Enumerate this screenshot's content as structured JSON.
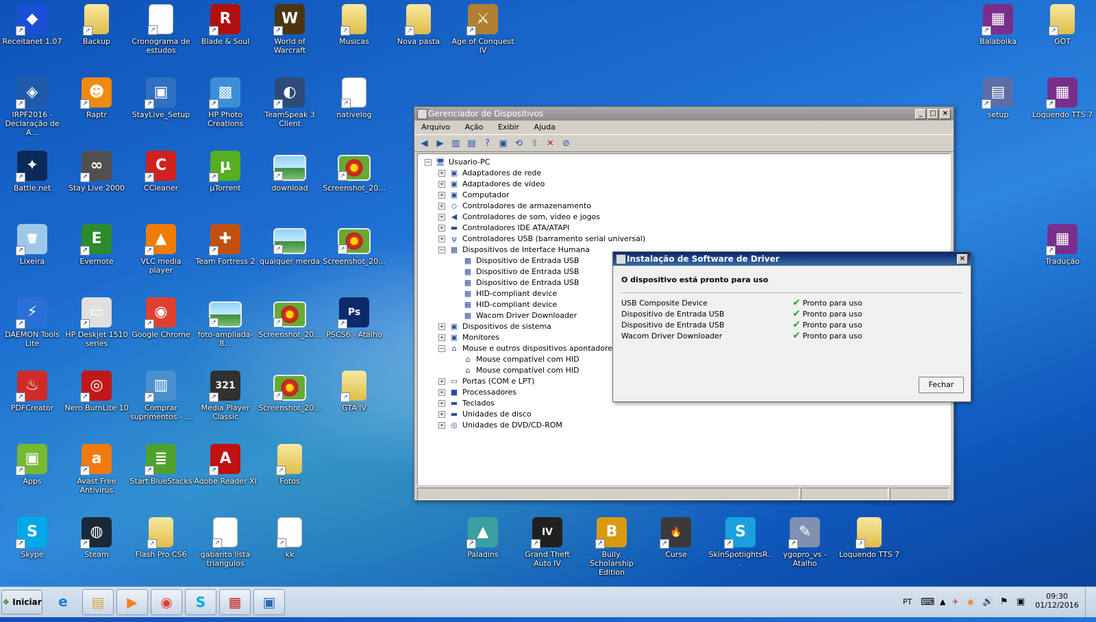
{
  "desktop": {
    "icons": [
      {
        "label": "Receitanet 1.07",
        "col": 0,
        "row": 0,
        "kind": "app",
        "color": "#1b4fd8",
        "glyph": "◆"
      },
      {
        "label": "Backup",
        "col": 1,
        "row": 0,
        "kind": "folder"
      },
      {
        "label": "Cronograma de estudos",
        "col": 2,
        "row": 0,
        "kind": "doc"
      },
      {
        "label": "Blade & Soul",
        "col": 3,
        "row": 0,
        "kind": "app",
        "color": "#b01010",
        "glyph": "R"
      },
      {
        "label": "World of Warcraft",
        "col": 4,
        "row": 0,
        "kind": "app",
        "color": "#4a3510",
        "glyph": "W"
      },
      {
        "label": "Musicas",
        "col": 5,
        "row": 0,
        "kind": "folder"
      },
      {
        "label": "Nova pasta",
        "col": 6,
        "row": 0,
        "kind": "folder"
      },
      {
        "label": "Age of Conquest IV",
        "col": 7,
        "row": 0,
        "kind": "app",
        "color": "#b08030",
        "glyph": "⚔"
      },
      {
        "label": "Balabolka",
        "col": 15,
        "row": 0,
        "kind": "app",
        "color": "#7a2e8a",
        "glyph": "▦"
      },
      {
        "label": "GOT",
        "col": 16,
        "row": 0,
        "kind": "folder"
      },
      {
        "label": "IRPF2016 - Declaração de A...",
        "col": 0,
        "row": 1,
        "kind": "app",
        "color": "#1e5aa8",
        "glyph": "◈"
      },
      {
        "label": "Raptr",
        "col": 1,
        "row": 1,
        "kind": "app",
        "color": "#f08a10",
        "glyph": "☻"
      },
      {
        "label": "StayLive_Setup",
        "col": 2,
        "row": 1,
        "kind": "app",
        "color": "#3070c0",
        "glyph": "▣"
      },
      {
        "label": "HP Photo Creations",
        "col": 3,
        "row": 1,
        "kind": "app",
        "color": "#3d8ed8",
        "glyph": "▩"
      },
      {
        "label": "TeamSpeak 3 Client",
        "col": 4,
        "row": 1,
        "kind": "app",
        "color": "#2c4a7a",
        "glyph": "◐"
      },
      {
        "label": "nativelog",
        "col": 5,
        "row": 1,
        "kind": "doc"
      },
      {
        "label": "setup",
        "col": 15,
        "row": 1,
        "kind": "app",
        "color": "#5a6ea8",
        "glyph": "▤"
      },
      {
        "label": "Loquendo TTS 7",
        "col": 16,
        "row": 1,
        "kind": "app",
        "color": "#7a2e8a",
        "glyph": "▦"
      },
      {
        "label": "Battle.net",
        "col": 0,
        "row": 2,
        "kind": "app",
        "color": "#0a2a5a",
        "glyph": "✦"
      },
      {
        "label": "Stay Live 2000",
        "col": 1,
        "row": 2,
        "kind": "app",
        "color": "#505050",
        "glyph": "∞"
      },
      {
        "label": "CCleaner",
        "col": 2,
        "row": 2,
        "kind": "app",
        "color": "#d02020",
        "glyph": "C"
      },
      {
        "label": "µTorrent",
        "col": 3,
        "row": 2,
        "kind": "app",
        "color": "#54b020",
        "glyph": "µ"
      },
      {
        "label": "download",
        "col": 4,
        "row": 2,
        "kind": "pic"
      },
      {
        "label": "Screenshot_20...",
        "col": 5,
        "row": 2,
        "kind": "flower"
      },
      {
        "label": "Lixeira",
        "col": 0,
        "row": 3,
        "kind": "app",
        "color": "#9fc8e8",
        "glyph": "🗑"
      },
      {
        "label": "Evernote",
        "col": 1,
        "row": 3,
        "kind": "app",
        "color": "#2d8a2d",
        "glyph": "E"
      },
      {
        "label": "VLC media player",
        "col": 2,
        "row": 3,
        "kind": "app",
        "color": "#f07c00",
        "glyph": "▲"
      },
      {
        "label": "Team Fortress 2",
        "col": 3,
        "row": 3,
        "kind": "app",
        "color": "#c05010",
        "glyph": "✚"
      },
      {
        "label": "qualquer merda",
        "col": 4,
        "row": 3,
        "kind": "pic"
      },
      {
        "label": "Screenshot_20...",
        "col": 5,
        "row": 3,
        "kind": "flower"
      },
      {
        "label": "Tradução",
        "col": 16,
        "row": 3,
        "kind": "app",
        "color": "#7a2e8a",
        "glyph": "▦"
      },
      {
        "label": "DAEMON Tools Lite",
        "col": 0,
        "row": 4,
        "kind": "app",
        "color": "#2a6fd8",
        "glyph": "⚡"
      },
      {
        "label": "HP Deskjet 1510 series",
        "col": 1,
        "row": 4,
        "kind": "app",
        "color": "#e0e0e0",
        "glyph": "▭"
      },
      {
        "label": "Google Chrome",
        "col": 2,
        "row": 4,
        "kind": "app",
        "color": "#e04030",
        "glyph": "◉"
      },
      {
        "label": "foto-ampliada-8...",
        "col": 3,
        "row": 4,
        "kind": "pic"
      },
      {
        "label": "Screenshot_20...",
        "col": 4,
        "row": 4,
        "kind": "flower"
      },
      {
        "label": "PSCS6 - Atalho",
        "col": 5,
        "row": 4,
        "kind": "app",
        "color": "#0a2a6a",
        "glyph": "Ps"
      },
      {
        "label": "PDFCreator",
        "col": 0,
        "row": 5,
        "kind": "app",
        "color": "#d02a2a",
        "glyph": "♨"
      },
      {
        "label": "Nero BurnLite 10",
        "col": 1,
        "row": 5,
        "kind": "app",
        "color": "#c01818",
        "glyph": "◎"
      },
      {
        "label": "Comprar suprimentos - ...",
        "col": 2,
        "row": 5,
        "kind": "app",
        "color": "#4a90d0",
        "glyph": "▥"
      },
      {
        "label": "Media Player Classic",
        "col": 3,
        "row": 5,
        "kind": "app",
        "color": "#303030",
        "glyph": "321"
      },
      {
        "label": "Screenshot_20...",
        "col": 4,
        "row": 5,
        "kind": "flower"
      },
      {
        "label": "GTA IV",
        "col": 5,
        "row": 5,
        "kind": "folder"
      },
      {
        "label": "Apps",
        "col": 0,
        "row": 6,
        "kind": "app",
        "color": "#78b830",
        "glyph": "▣"
      },
      {
        "label": "Avast Free Antivirus",
        "col": 1,
        "row": 6,
        "kind": "app",
        "color": "#f07a10",
        "glyph": "a"
      },
      {
        "label": "Start BlueStacks",
        "col": 2,
        "row": 6,
        "kind": "app",
        "color": "#50a030",
        "glyph": "≣"
      },
      {
        "label": "Adobe Reader XI",
        "col": 3,
        "row": 6,
        "kind": "app",
        "color": "#c01010",
        "glyph": "A"
      },
      {
        "label": "Fotos",
        "col": 4,
        "row": 6,
        "kind": "folder"
      },
      {
        "label": "Skype",
        "col": 0,
        "row": 7,
        "kind": "app",
        "color": "#00a8e8",
        "glyph": "S"
      },
      {
        "label": "Steam",
        "col": 1,
        "row": 7,
        "kind": "app",
        "color": "#1b2838",
        "glyph": "◍"
      },
      {
        "label": "Flash Pro CS6",
        "col": 2,
        "row": 7,
        "kind": "folder"
      },
      {
        "label": "gabarito lista triangulos",
        "col": 3,
        "row": 7,
        "kind": "doc"
      },
      {
        "label": "kk",
        "col": 4,
        "row": 7,
        "kind": "doc"
      },
      {
        "label": "Paladins",
        "col": 7,
        "row": 7,
        "kind": "app",
        "color": "#3aa0a0",
        "glyph": "▲"
      },
      {
        "label": "Grand Theft Auto IV",
        "col": 8,
        "row": 7,
        "kind": "app",
        "color": "#202020",
        "glyph": "IV"
      },
      {
        "label": "Bully. Scholarship Edition",
        "col": 9,
        "row": 7,
        "kind": "app",
        "color": "#d89a10",
        "glyph": "B"
      },
      {
        "label": "Curse",
        "col": 10,
        "row": 7,
        "kind": "app",
        "color": "#3a3a3a",
        "glyph": "🔥"
      },
      {
        "label": "SkinSpotlightsR...",
        "col": 11,
        "row": 7,
        "kind": "app",
        "color": "#1aa0e0",
        "glyph": "S"
      },
      {
        "label": "ygopro_vs - Atalho",
        "col": 12,
        "row": 7,
        "kind": "app",
        "color": "#8090b0",
        "glyph": "✎"
      },
      {
        "label": "Loquendo TTS 7",
        "col": 13,
        "row": 7,
        "kind": "folder"
      }
    ]
  },
  "devmgr": {
    "title": "Gerenciador de Dispositivos",
    "menu": [
      "Arquivo",
      "Ação",
      "Exibir",
      "Ajuda"
    ],
    "tree": [
      {
        "label": "Usuario-PC",
        "level": 0,
        "exp": "−",
        "icon": "🖥"
      },
      {
        "label": "Adaptadores de rede",
        "level": 1,
        "exp": "+",
        "icon": "▣"
      },
      {
        "label": "Adaptadores de vídeo",
        "level": 1,
        "exp": "+",
        "icon": "▣"
      },
      {
        "label": "Computador",
        "level": 1,
        "exp": "+",
        "icon": "▣"
      },
      {
        "label": "Controladores de armazenamento",
        "level": 1,
        "exp": "+",
        "icon": "◇"
      },
      {
        "label": "Controladores de som, vídeo e jogos",
        "level": 1,
        "exp": "+",
        "icon": "◀"
      },
      {
        "label": "Controladores IDE ATA/ATAPI",
        "level": 1,
        "exp": "+",
        "icon": "▬"
      },
      {
        "label": "Controladores USB (barramento serial universal)",
        "level": 1,
        "exp": "+",
        "icon": "ψ"
      },
      {
        "label": "Dispositivos de Interface Humana",
        "level": 1,
        "exp": "−",
        "icon": "▦"
      },
      {
        "label": "Dispositivo de Entrada USB",
        "level": 2,
        "exp": "",
        "icon": "▦"
      },
      {
        "label": "Dispositivo de Entrada USB",
        "level": 2,
        "exp": "",
        "icon": "▦"
      },
      {
        "label": "Dispositivo de Entrada USB",
        "level": 2,
        "exp": "",
        "icon": "▦"
      },
      {
        "label": "HID-compliant device",
        "level": 2,
        "exp": "",
        "icon": "▦"
      },
      {
        "label": "HID-compliant device",
        "level": 2,
        "exp": "",
        "icon": "▦"
      },
      {
        "label": "Wacom Driver Downloader",
        "level": 2,
        "exp": "",
        "icon": "▦"
      },
      {
        "label": "Dispositivos de sistema",
        "level": 1,
        "exp": "+",
        "icon": "▣"
      },
      {
        "label": "Monitores",
        "level": 1,
        "exp": "+",
        "icon": "▣"
      },
      {
        "label": "Mouse e outros dispositivos apontadores",
        "level": 1,
        "exp": "−",
        "icon": "⌂"
      },
      {
        "label": "Mouse compatível com HID",
        "level": 2,
        "exp": "",
        "icon": "⌂"
      },
      {
        "label": "Mouse compatível com HID",
        "level": 2,
        "exp": "",
        "icon": "⌂"
      },
      {
        "label": "Portas (COM e LPT)",
        "level": 1,
        "exp": "+",
        "icon": "▭"
      },
      {
        "label": "Processadores",
        "level": 1,
        "exp": "+",
        "icon": "■"
      },
      {
        "label": "Teclados",
        "level": 1,
        "exp": "+",
        "icon": "▬"
      },
      {
        "label": "Unidades de disco",
        "level": 1,
        "exp": "+",
        "icon": "▬"
      },
      {
        "label": "Unidades de DVD/CD-ROM",
        "level": 1,
        "exp": "+",
        "icon": "◎"
      }
    ]
  },
  "driver_dialog": {
    "title": "Instalação de Software de Driver",
    "heading": "O dispositivo está pronto para uso",
    "rows": [
      {
        "device": "USB Composite Device",
        "status": "Pronto para uso"
      },
      {
        "device": "Dispositivo de Entrada USB",
        "status": "Pronto para uso"
      },
      {
        "device": "Dispositivo de Entrada USB",
        "status": "Pronto para uso"
      },
      {
        "device": "Wacom Driver Downloader",
        "status": "Pronto para uso"
      }
    ],
    "close_button": "Fechar"
  },
  "taskbar": {
    "start_label": "Iniciar",
    "items": [
      {
        "name": "ie",
        "glyph": "e",
        "color": "#1a7ad8"
      },
      {
        "name": "explorer",
        "glyph": "▤",
        "color": "#d8a830"
      },
      {
        "name": "media-player",
        "glyph": "▶",
        "color": "#f08020"
      },
      {
        "name": "chrome",
        "glyph": "◉",
        "color": "#e04030"
      },
      {
        "name": "skype",
        "glyph": "S",
        "color": "#00a8e8"
      },
      {
        "name": "toolbox",
        "glyph": "▦",
        "color": "#c02828"
      },
      {
        "name": "device-manager",
        "glyph": "▣",
        "color": "#2a6ab0"
      }
    ],
    "language": "PT",
    "time": "09:30",
    "date": "01/12/2016"
  }
}
